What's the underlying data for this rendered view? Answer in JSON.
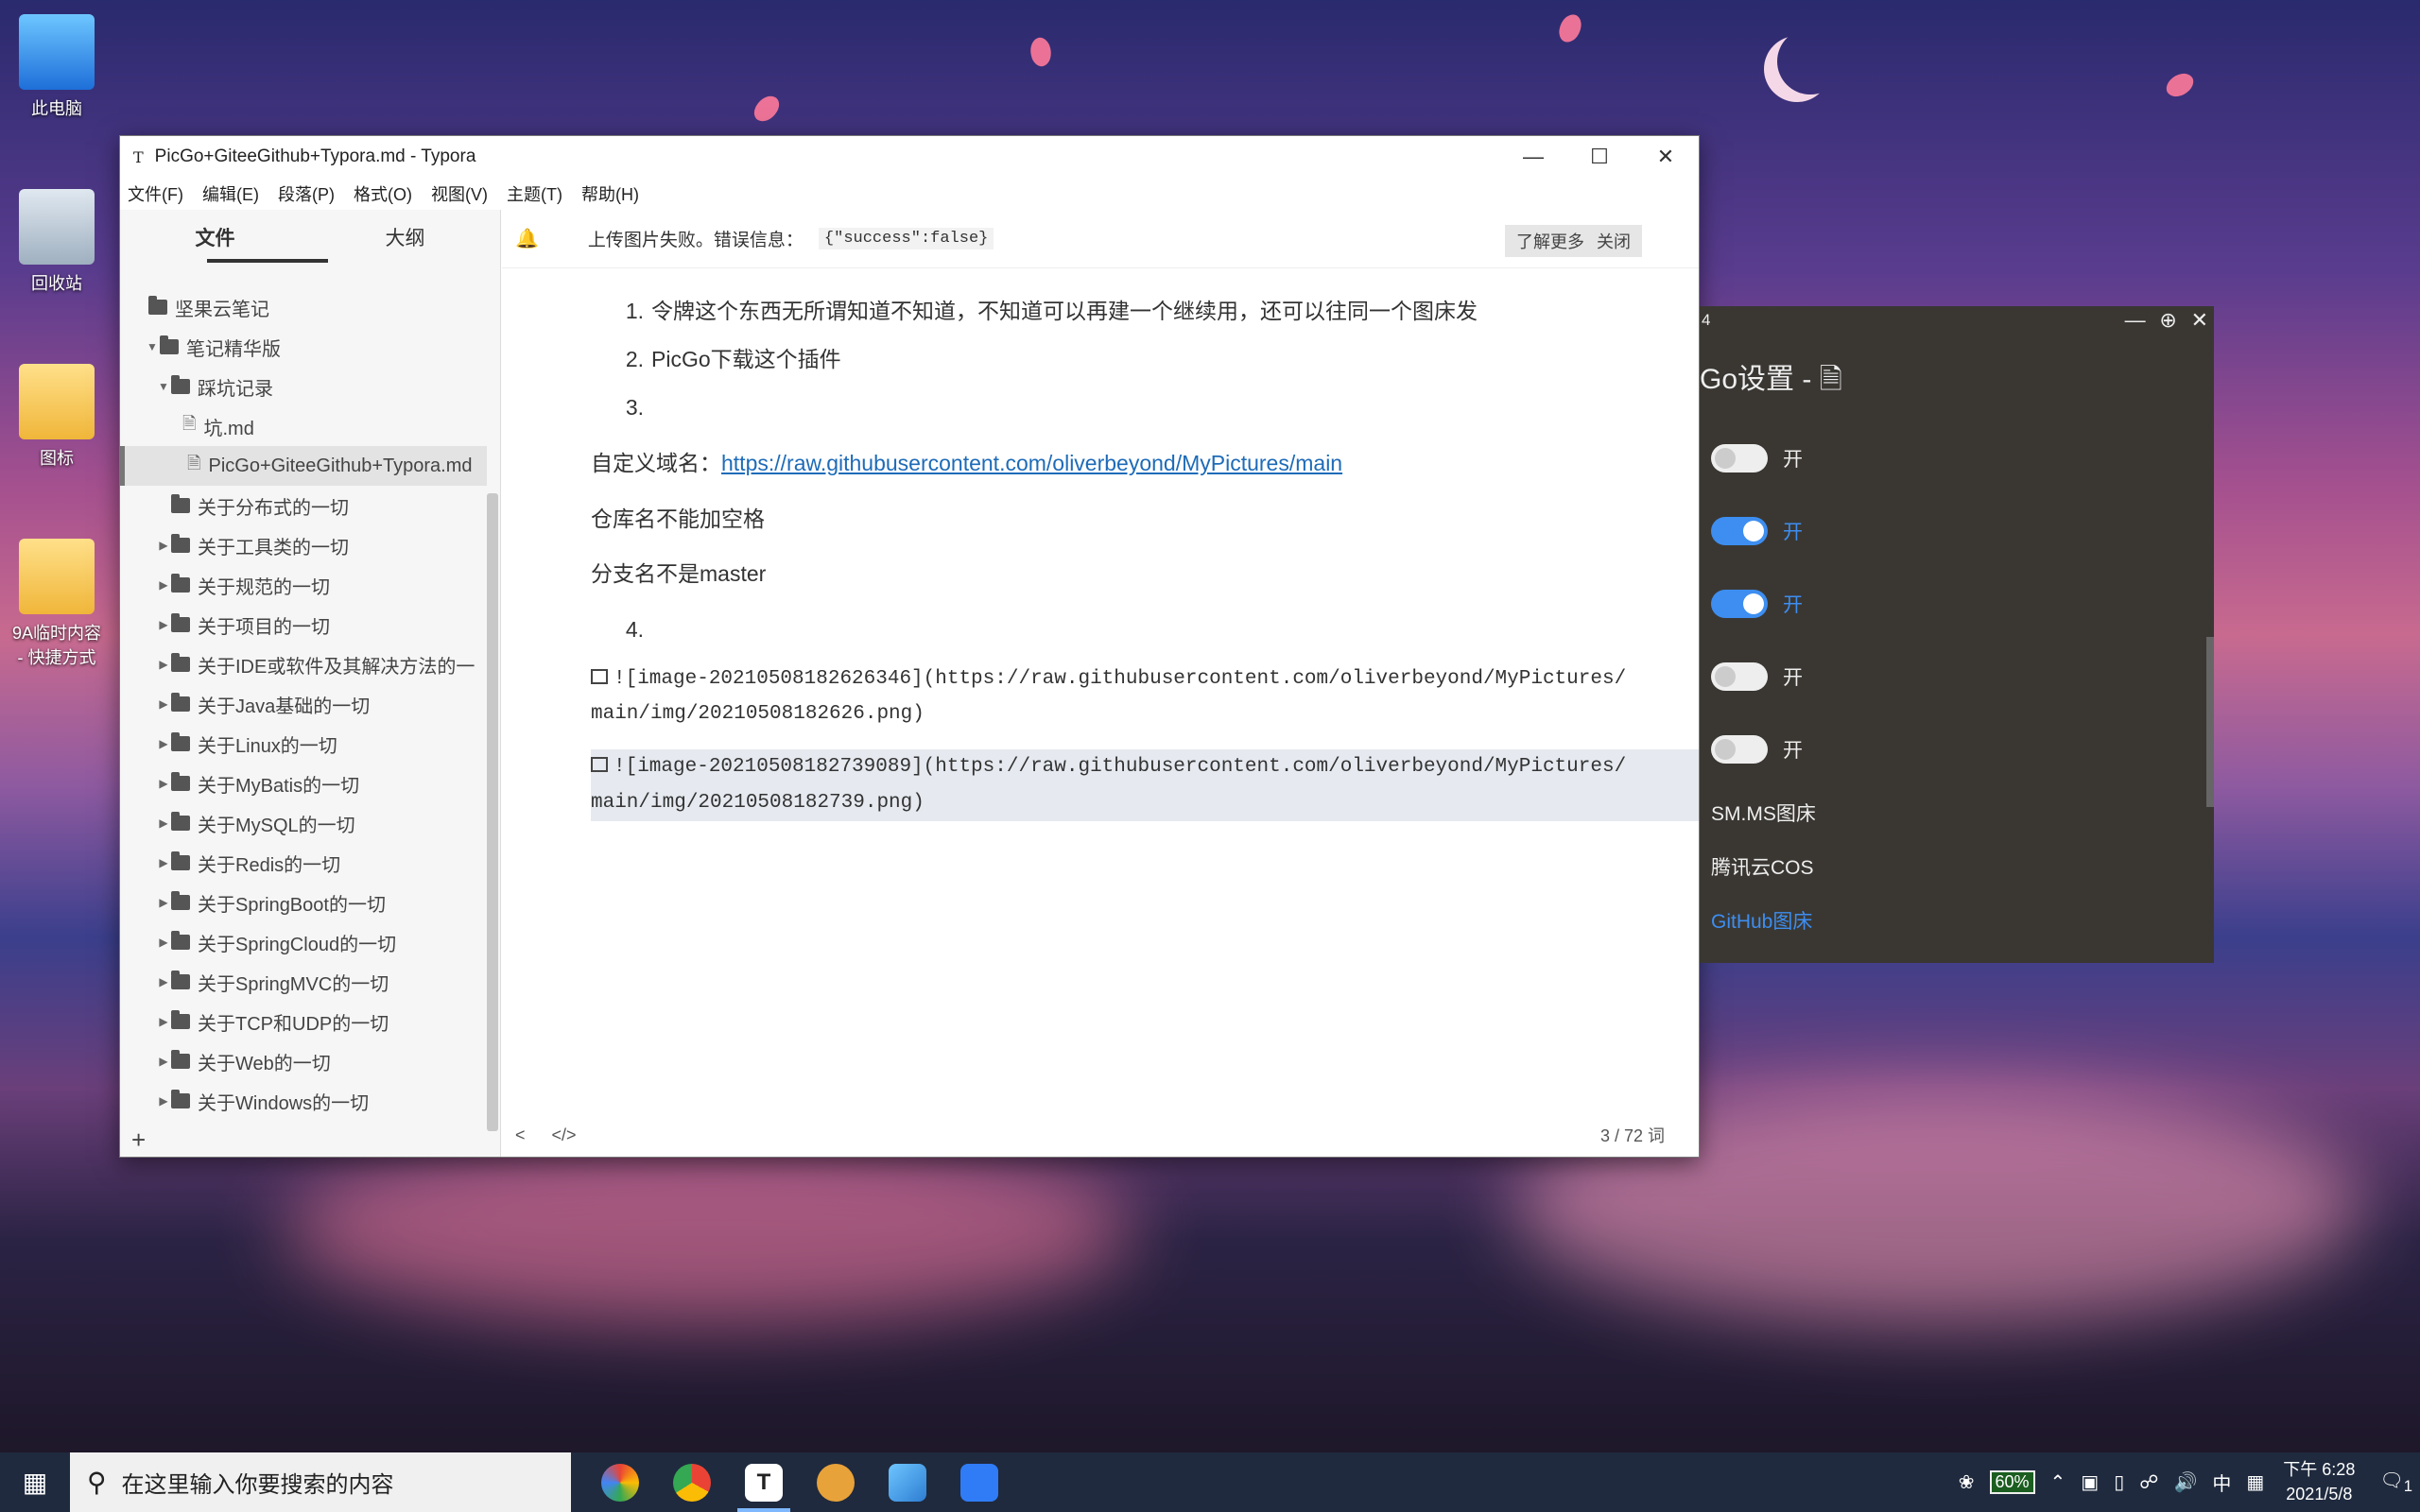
{
  "desktop": {
    "icons": [
      {
        "label": "此电脑"
      },
      {
        "label": "回收站"
      },
      {
        "label": "图标"
      },
      {
        "label": "9A临时内容 - 快捷方式"
      }
    ]
  },
  "typora": {
    "title": "PicGo+GiteeGithub+Typora.md - Typora",
    "menu": [
      "文件(F)",
      "编辑(E)",
      "段落(P)",
      "格式(O)",
      "视图(V)",
      "主题(T)",
      "帮助(H)"
    ],
    "sidebar": {
      "tabs": [
        "文件",
        "大纲"
      ],
      "tree": [
        {
          "label": "坚果云笔记",
          "level": 0,
          "type": "folder",
          "arrow": ""
        },
        {
          "label": "笔记精华版",
          "level": 1,
          "type": "folder",
          "arrow": "▼"
        },
        {
          "label": "踩坑记录",
          "level": 2,
          "type": "folder",
          "arrow": "▼"
        },
        {
          "label": "坑.md",
          "level": 3,
          "type": "file",
          "arrow": ""
        },
        {
          "label": "PicGo+GiteeGithub+Typora.md",
          "level": 3,
          "type": "file",
          "arrow": "",
          "selected": true
        },
        {
          "label": "关于分布式的一切",
          "level": 2,
          "type": "folder",
          "arrow": ""
        },
        {
          "label": "关于工具类的一切",
          "level": 2,
          "type": "folder",
          "arrow": "▶"
        },
        {
          "label": "关于规范的一切",
          "level": 2,
          "type": "folder",
          "arrow": "▶"
        },
        {
          "label": "关于项目的一切",
          "level": 2,
          "type": "folder",
          "arrow": "▶"
        },
        {
          "label": "关于IDE或软件及其解决方法的一",
          "level": 2,
          "type": "folder",
          "arrow": "▶"
        },
        {
          "label": "关于Java基础的一切",
          "level": 2,
          "type": "folder",
          "arrow": "▶"
        },
        {
          "label": "关于Linux的一切",
          "level": 2,
          "type": "folder",
          "arrow": "▶"
        },
        {
          "label": "关于MyBatis的一切",
          "level": 2,
          "type": "folder",
          "arrow": "▶"
        },
        {
          "label": "关于MySQL的一切",
          "level": 2,
          "type": "folder",
          "arrow": "▶"
        },
        {
          "label": "关于Redis的一切",
          "level": 2,
          "type": "folder",
          "arrow": "▶"
        },
        {
          "label": "关于SpringBoot的一切",
          "level": 2,
          "type": "folder",
          "arrow": "▶"
        },
        {
          "label": "关于SpringCloud的一切",
          "level": 2,
          "type": "folder",
          "arrow": "▶"
        },
        {
          "label": "关于SpringMVC的一切",
          "level": 2,
          "type": "folder",
          "arrow": "▶"
        },
        {
          "label": "关于TCP和UDP的一切",
          "level": 2,
          "type": "folder",
          "arrow": "▶"
        },
        {
          "label": "关于Web的一切",
          "level": 2,
          "type": "folder",
          "arrow": "▶"
        },
        {
          "label": "关于Windows的一切",
          "level": 2,
          "type": "folder",
          "arrow": "▶"
        }
      ],
      "add": "+"
    },
    "notice": {
      "message": "上传图片失败。错误信息：",
      "code": "{\"success\":false}",
      "learn_more": "了解更多",
      "close": "关闭"
    },
    "content": {
      "list1": [
        {
          "num": "1.",
          "text": "令牌这个东西无所谓知道不知道，不知道可以再建一个继续用，还可以往同一个图床发"
        },
        {
          "num": "2.",
          "text": "PicGo下载这个插件"
        },
        {
          "num": "3.",
          "text": ""
        }
      ],
      "domain_label": "自定义域名：",
      "domain_link": "https://raw.githubusercontent.com/oliverbeyond/MyPictures/main",
      "p1": "仓库名不能加空格",
      "p2": "分支名不是master",
      "list2_num": "4.",
      "code1_line1": "![image-20210508182626346](https://raw.githubusercontent.com/oliverbeyond/MyPictures/",
      "code1_line2": "main/img/20210508182626.png)",
      "code2_line1": "![image-20210508182739089](https://raw.githubusercontent.com/oliverbeyond/MyPictures/",
      "code2_line2": "main/img/20210508182739.png)"
    },
    "status": {
      "prev": "<",
      "source": "</>",
      "word_count": "3 / 72 词"
    }
  },
  "picgo": {
    "bar_left": "4",
    "title": "Go设置 - ",
    "toggles": [
      {
        "label": "开",
        "on": false
      },
      {
        "label": "开",
        "on": true
      },
      {
        "label": "开",
        "on": true
      },
      {
        "label": "开",
        "on": false
      },
      {
        "label": "开",
        "on": false
      }
    ],
    "links": [
      "SM.MS图床",
      "腾讯云COS",
      "GitHub图床"
    ]
  },
  "taskbar": {
    "search_placeholder": "在这里输入你要搜索的内容",
    "battery": "60%",
    "ime": "中",
    "time": "下午 6:28",
    "date": "2021/5/8",
    "notifications": "1"
  }
}
